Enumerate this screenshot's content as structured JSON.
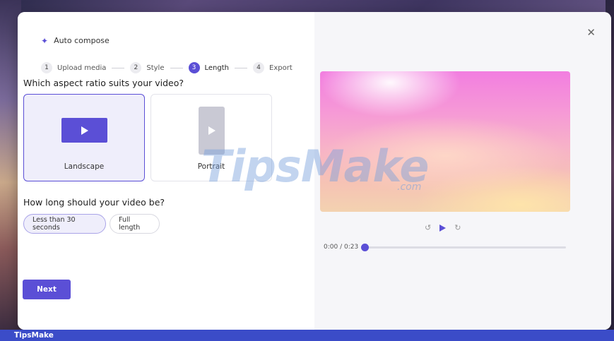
{
  "header": {
    "title": "Auto compose",
    "icon": "sparkle-icon"
  },
  "steps": [
    {
      "num": "1",
      "label": "Upload media",
      "active": false
    },
    {
      "num": "2",
      "label": "Style",
      "active": false
    },
    {
      "num": "3",
      "label": "Length",
      "active": true
    },
    {
      "num": "4",
      "label": "Export",
      "active": false
    }
  ],
  "aspect": {
    "question": "Which aspect ratio suits your video?",
    "options": [
      {
        "label": "Landscape",
        "selected": true
      },
      {
        "label": "Portrait",
        "selected": false
      }
    ]
  },
  "length": {
    "question": "How long should your video be?",
    "options": [
      {
        "label": "Less than 30 seconds",
        "selected": true
      },
      {
        "label": "Full length",
        "selected": false
      }
    ]
  },
  "actions": {
    "next_label": "Next",
    "close_icon": "close-icon"
  },
  "player": {
    "time": "0:00 / 0:23",
    "progress": 0.0
  },
  "watermark": {
    "main": "TipsMake",
    "suffix": ".com"
  },
  "footer": {
    "label": "TipsMake"
  },
  "colors": {
    "accent": "#5b4fd6",
    "footer": "#3b4cc8"
  }
}
